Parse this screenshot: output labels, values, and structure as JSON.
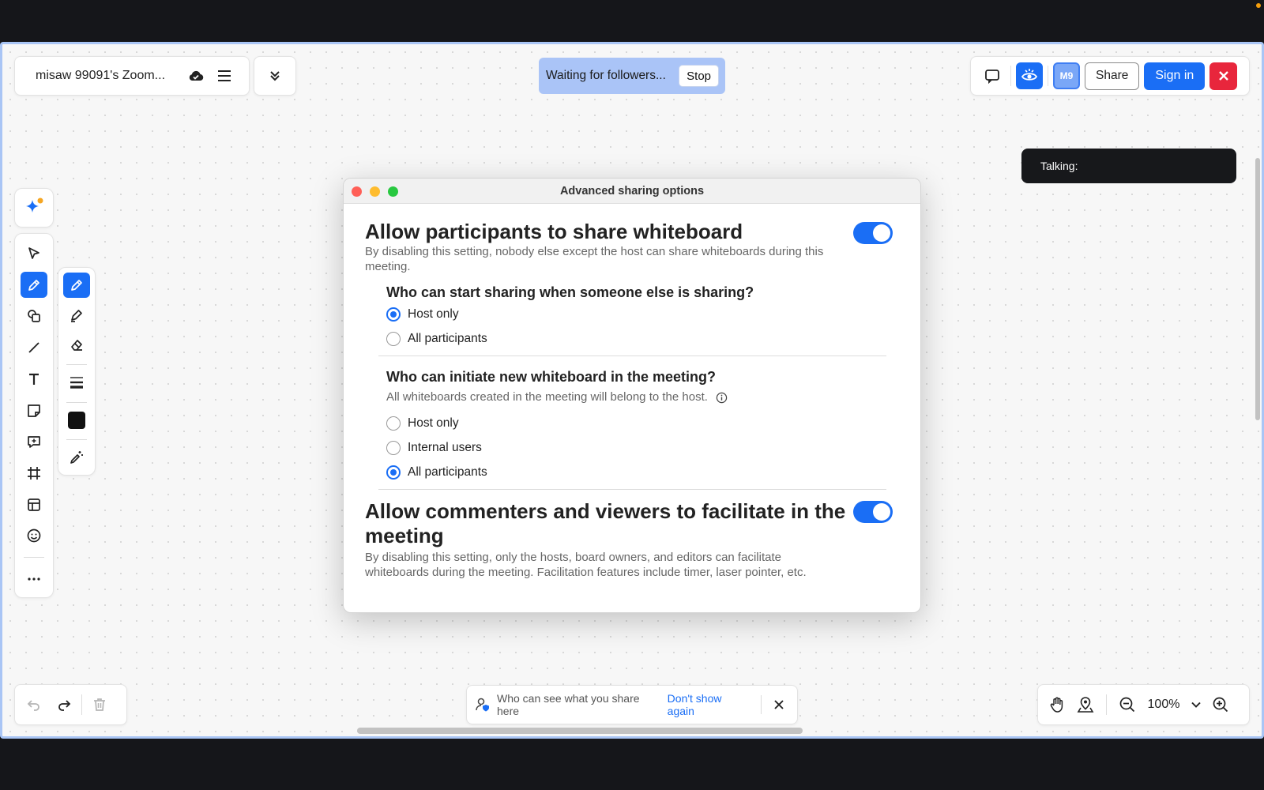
{
  "header": {
    "board_title": "misaw 99091's Zoom...",
    "waiting_text": "Waiting for followers...",
    "stop_label": "Stop",
    "avatar_initials": "M9",
    "share_label": "Share",
    "signin_label": "Sign in"
  },
  "talking": {
    "label": "Talking:"
  },
  "dialog": {
    "title": "Advanced sharing options",
    "section1": {
      "title": "Allow participants to share whiteboard",
      "description": "By disabling this setting, nobody else except the host can share whiteboards during this meeting.",
      "enabled": true,
      "q1": {
        "title": "Who can start sharing when someone else is sharing?",
        "options": [
          "Host only",
          "All participants"
        ],
        "selected": "Host only"
      },
      "q2": {
        "title": "Who can initiate new whiteboard in the meeting?",
        "description": "All whiteboards created in the meeting will belong to the host.",
        "options": [
          "Host only",
          "Internal users",
          "All participants"
        ],
        "selected": "All participants"
      }
    },
    "section2": {
      "title": "Allow commenters and viewers to facilitate in the meeting",
      "description": "By disabling this setting, only the hosts, board owners, and editors can facilitate whiteboards during the meeting. Facilitation features include timer, laser pointer, etc.",
      "enabled": true
    }
  },
  "notice": {
    "text": "Who can see what you share here",
    "link": "Don't show again"
  },
  "zoom": {
    "level": "100%"
  },
  "colors": {
    "accent": "#1a6ef5",
    "close": "#e8263c",
    "banner": "#aac4f7",
    "pen_color": "#111111"
  },
  "icons": {
    "tools": [
      "select-icon",
      "pen-icon",
      "shapes-icon",
      "line-icon",
      "text-icon",
      "sticky-note-icon",
      "comment-icon",
      "frame-icon",
      "template-icon",
      "emoji-icon",
      "more-icon"
    ],
    "pen_tools": [
      "pen-icon",
      "highlighter-icon",
      "eraser-icon",
      "stroke-width-icon",
      "color-swatch",
      "magic-pen-icon"
    ]
  }
}
